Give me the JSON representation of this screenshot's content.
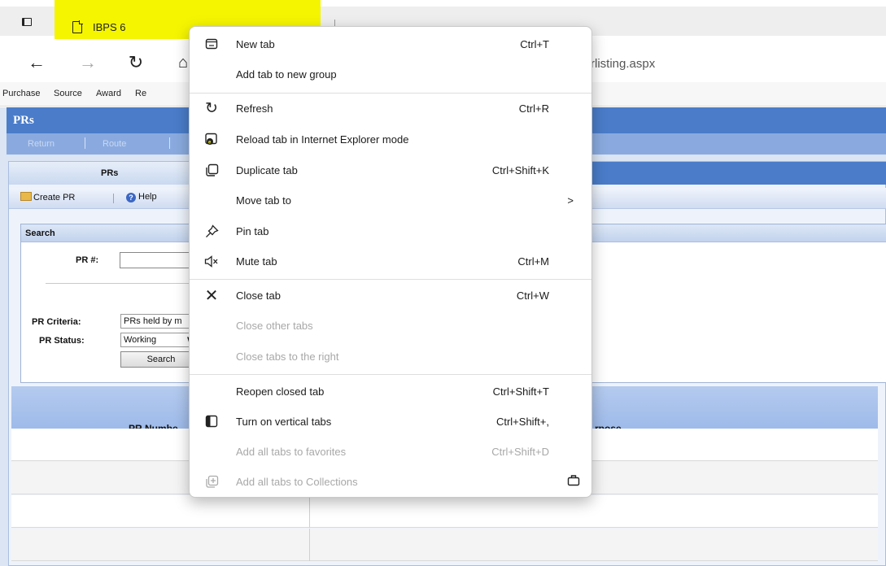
{
  "browser": {
    "tab_title": "IBPS 6",
    "url_visible": "s/prlisting.aspx",
    "favorites": [
      "Purchase",
      "Source",
      "Award",
      "Re"
    ]
  },
  "page": {
    "header_title": "PRs",
    "actions": [
      "Return",
      "Route"
    ],
    "panel_title": "PRs",
    "toolbar": {
      "create_label": "Create PR",
      "help_label": "Help"
    },
    "search": {
      "title": "Search",
      "pr_number_label": "PR #:",
      "criteria_label": "PR Criteria:",
      "criteria_value": "PRs held by m",
      "status_label": "PR Status:",
      "status_value": "Working",
      "search_button": "Search"
    },
    "grid": {
      "col_pr_number": "PR Numbe",
      "col_purpose": "rpose"
    }
  },
  "context_menu": {
    "items": [
      {
        "label": "New tab",
        "shortcut": "Ctrl+T",
        "icon": "new-tab-icon"
      },
      {
        "label": "Add tab to new group",
        "shortcut": ""
      },
      {
        "label": "Refresh",
        "shortcut": "Ctrl+R",
        "icon": "refresh-icon"
      },
      {
        "label": "Reload tab in Internet Explorer mode",
        "shortcut": "",
        "icon": "ie-mode-icon",
        "highlighted": true
      },
      {
        "label": "Duplicate tab",
        "shortcut": "Ctrl+Shift+K",
        "icon": "duplicate-icon"
      },
      {
        "label": "Move tab to",
        "shortcut": ">"
      },
      {
        "label": "Pin tab",
        "shortcut": "",
        "icon": "pin-icon"
      },
      {
        "label": "Mute tab",
        "shortcut": "Ctrl+M",
        "icon": "mute-icon"
      },
      {
        "label": "Close tab",
        "shortcut": "Ctrl+W",
        "icon": "close-icon"
      },
      {
        "label": "Close other tabs",
        "shortcut": "",
        "disabled": true
      },
      {
        "label": "Close tabs to the right",
        "shortcut": "",
        "disabled": true
      },
      {
        "label": "Reopen closed tab",
        "shortcut": "Ctrl+Shift+T"
      },
      {
        "label": "Turn on vertical tabs",
        "shortcut": "Ctrl+Shift+,",
        "icon": "vertical-tabs-icon"
      },
      {
        "label": "Add all tabs to favorites",
        "shortcut": "Ctrl+Shift+D",
        "disabled": true
      },
      {
        "label": "Add all tabs to Collections",
        "shortcut": "",
        "icon": "collections-icon",
        "disabled": true
      }
    ]
  },
  "colors": {
    "highlight": "#f5f500",
    "page_header": "#4a7cc9"
  }
}
